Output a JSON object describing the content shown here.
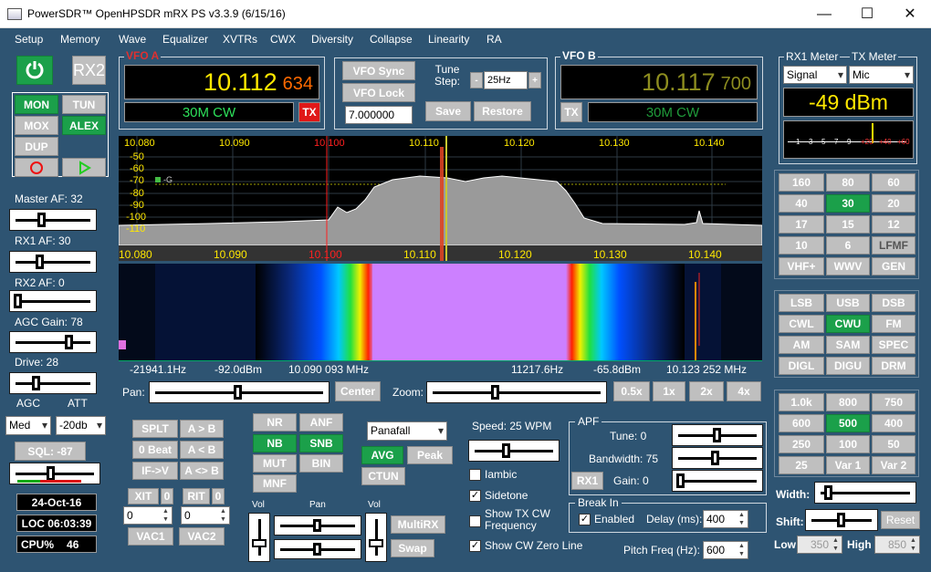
{
  "window": {
    "title": "PowerSDR™ OpenHPSDR mRX PS v3.3.9 (6/15/16)",
    "min": "—",
    "max": "☐",
    "close": "✕"
  },
  "menu": [
    "Setup",
    "Memory",
    "Wave",
    "Equalizer",
    "XVTRs",
    "CWX",
    "Diversity",
    "Collapse",
    "Linearity",
    "RA"
  ],
  "left": {
    "power_icon": "power-icon",
    "rx2": "RX2",
    "mon": "MON",
    "tun": "TUN",
    "mox": "MOX",
    "alex": "ALEX",
    "dup": "DUP",
    "rec_icon": "record-icon",
    "play_icon": "play-icon",
    "master_af": "Master AF:  32",
    "rx1_af": "RX1 AF:  30",
    "rx2_af": "RX2 AF:  0",
    "agc_gain": "AGC Gain:  78",
    "drive": "Drive:  28",
    "agc_label": "AGC",
    "att_label": "ATT",
    "agc_value": "Med",
    "att_value": "-20db",
    "sql": "SQL: -87",
    "date": "24-Oct-16",
    "loc": "LOC 06:03:39",
    "cpu_label": "CPU%",
    "cpu_value": "46"
  },
  "vfo_a": {
    "label": "VFO A",
    "freq_main": "10.112",
    "freq_sub": "634",
    "mode": "30M CW",
    "tx": "TX"
  },
  "vfo_b": {
    "label": "VFO B",
    "freq_main": "10.117",
    "freq_sub": "700",
    "mode": "30M CW",
    "tx": "TX"
  },
  "vfo_mid": {
    "sync": "VFO Sync",
    "lock": "VFO Lock",
    "tune_step_label": "Tune\nStep:",
    "tune_step": "25Hz",
    "minus": "-",
    "plus": "+",
    "freq_entry": "7.000000",
    "save": "Save",
    "restore": "Restore"
  },
  "meter": {
    "rx1_label": "RX1 Meter",
    "tx_label": "TX Meter",
    "rx1_sel": "Signal",
    "tx_sel": "Mic",
    "reading": "-49 dBm",
    "scale": [
      "1",
      "3",
      "5",
      "7",
      "9",
      "+20",
      "+40",
      "+60"
    ]
  },
  "display": {
    "freq_ticks": [
      "10.080",
      "10.090",
      "10.100",
      "10.110",
      "10.120",
      "10.130",
      "10.140"
    ],
    "db_ticks": [
      "-50",
      "-60",
      "-70",
      "-80",
      "-90",
      "-100",
      "-110"
    ],
    "marker": "-G",
    "status": {
      "offset": "-21941.1Hz",
      "level": "-92.0dBm",
      "cursor": "10.090 093 MHz",
      "offset2": "11217.6Hz",
      "level2": "-65.8dBm",
      "cursor2": "10.123 252 MHz"
    }
  },
  "pan_row": {
    "pan": "Pan:",
    "center": "Center",
    "zoom": "Zoom:",
    "z05": "0.5x",
    "z1": "1x",
    "z2": "2x",
    "z4": "4x"
  },
  "bands": [
    "160",
    "80",
    "60",
    "40",
    "30",
    "20",
    "17",
    "15",
    "12",
    "10",
    "6",
    "LFMF",
    "VHF+",
    "WWV",
    "GEN"
  ],
  "modes": [
    "LSB",
    "USB",
    "DSB",
    "CWL",
    "CWU",
    "FM",
    "AM",
    "SAM",
    "SPEC",
    "DIGL",
    "DIGU",
    "DRM"
  ],
  "filters": [
    "1.0k",
    "800",
    "750",
    "600",
    "500",
    "400",
    "250",
    "100",
    "50",
    "25",
    "Var 1",
    "Var 2"
  ],
  "filter_ctl": {
    "width": "Width:",
    "shift": "Shift:",
    "reset": "Reset",
    "low": "Low",
    "low_val": "350",
    "high": "High",
    "high_val": "850"
  },
  "bottom": {
    "splt": "SPLT",
    "a_to_b": "A > B",
    "zero_beat": "0 Beat",
    "b_to_a": "A < B",
    "if_v": "IF->V",
    "swap_ab": "A <> B",
    "xit": "XIT",
    "xit_v": "0",
    "xit_num": "0",
    "rit": "RIT",
    "rit_v": "0",
    "rit_num": "0",
    "vac1": "VAC1",
    "vac2": "VAC2",
    "nr": "NR",
    "anf": "ANF",
    "nb": "NB",
    "snb": "SNB",
    "mut": "MUT",
    "bin": "BIN",
    "mnf": "MNF",
    "vol1": "Vol",
    "pan": "Pan",
    "vol2": "Vol",
    "multirx": "MultiRX",
    "swap": "Swap",
    "display_mode": "Panafall",
    "avg": "AVG",
    "peak": "Peak",
    "ctun": "CTUN"
  },
  "cw": {
    "speed": "Speed:  25 WPM",
    "iambic": "Iambic",
    "sidetone": "Sidetone",
    "show_tx": "Show TX CW\nFrequency",
    "show_zero": "Show CW Zero Line",
    "apf_group": "APF",
    "tune": "Tune:  0",
    "bandwidth": "Bandwidth:  75",
    "rx1": "RX1",
    "gain": "Gain:  0",
    "break_group": "Break In",
    "enabled": "Enabled",
    "delay_label": "Delay (ms):",
    "delay": "400",
    "pitch_label": "Pitch Freq (Hz):",
    "pitch": "600"
  }
}
